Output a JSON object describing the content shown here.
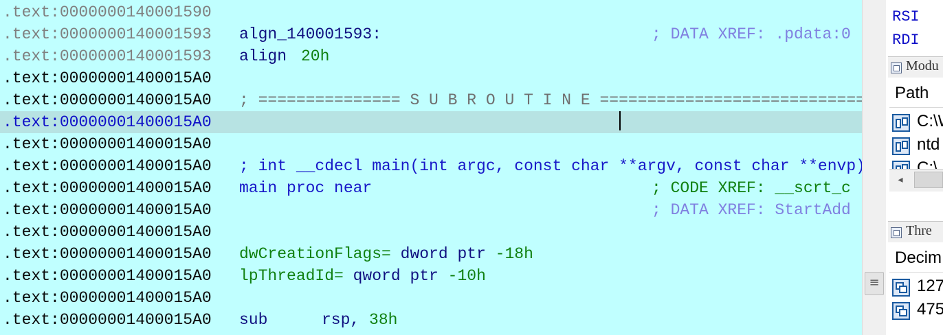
{
  "disasm": {
    "lines": [
      {
        "addr": ".text:0000000140001590"
      },
      {
        "addr": ".text:0000000140001593",
        "label": "algn_140001593:",
        "comment": "; DATA XREF: .pdata:0"
      },
      {
        "addr": ".text:0000000140001593",
        "mnemonic": "align",
        "operand": "20h"
      },
      {
        "addr": ".text:00000001400015A0"
      },
      {
        "addr": ".text:00000001400015A0",
        "separator": "; =============== S U B R O U T I N E ======================================="
      },
      {
        "addr": ".text:00000001400015A0"
      },
      {
        "addr": ".text:00000001400015A0"
      },
      {
        "addr": ".text:00000001400015A0",
        "decl": "; int __cdecl main(int argc, const char **argv, const char **envp)"
      },
      {
        "addr": ".text:00000001400015A0",
        "proc": "main proc near",
        "comment": "; CODE XREF: __scrt_c"
      },
      {
        "addr": ".text:00000001400015A0",
        "comment": "; DATA XREF: StartAdd"
      },
      {
        "addr": ".text:00000001400015A0"
      },
      {
        "addr": ".text:00000001400015A0",
        "var": "dwCreationFlags=",
        "type": " dword ptr ",
        "offset": "-18h"
      },
      {
        "addr": ".text:00000001400015A0",
        "var": "lpThreadId=",
        "type": " qword ptr ",
        "offset": "-10h"
      },
      {
        "addr": ".text:00000001400015A0"
      },
      {
        "addr": ".text:00000001400015A0",
        "mnemonic": "sub",
        "operand_reg": "rsp, ",
        "operand_imm": "38h"
      }
    ]
  },
  "registers": {
    "items": [
      "RSI",
      "RDI"
    ]
  },
  "modules": {
    "title": "Modu",
    "column": "Path",
    "rows": [
      "C:\\W",
      "ntd",
      "C:\\"
    ]
  },
  "threads": {
    "title": "Thre",
    "column": "Decim",
    "rows": [
      "127",
      "475"
    ]
  },
  "scrollbar": {
    "thumb_glyph": "≡",
    "left_arrow": "◂"
  },
  "colors": {
    "disasm_bg": "#c0ffff",
    "selected_line": "#b7e3e3",
    "address_blue": "#1010c8"
  }
}
